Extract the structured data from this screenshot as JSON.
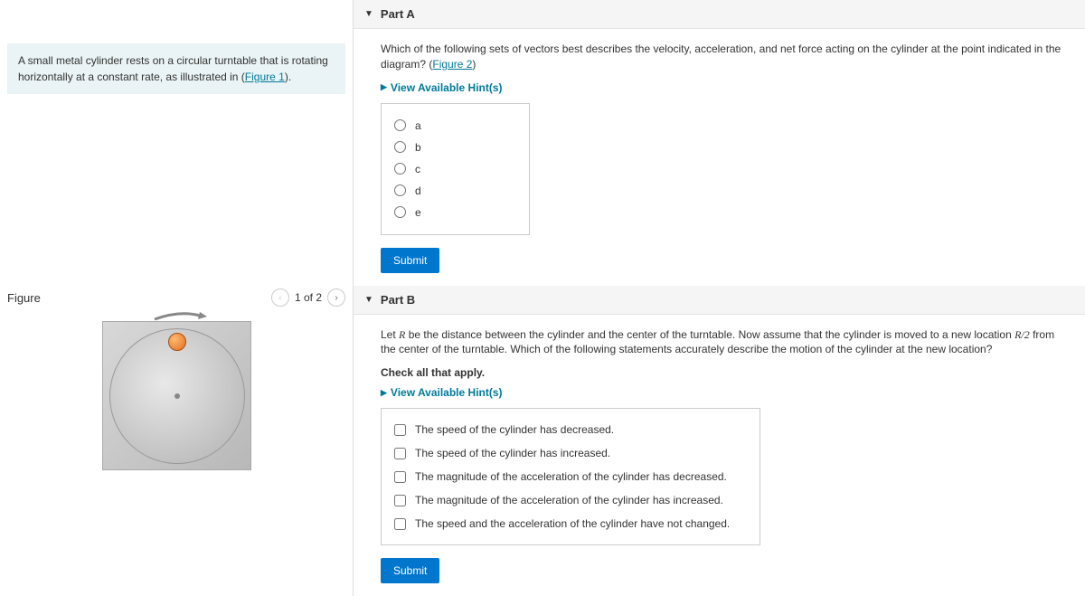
{
  "intro": {
    "text_before_link": "A small metal cylinder rests on a circular turntable that is rotating horizontally at a constant rate, as illustrated in (",
    "link_text": "Figure 1",
    "text_after_link": ")."
  },
  "figure": {
    "title": "Figure",
    "page_label": "1 of 2"
  },
  "partA": {
    "header": "Part A",
    "question_before_link": "Which of the following sets of vectors best describes the velocity, acceleration, and net force acting on the cylinder at the point indicated in the diagram? (",
    "question_link": "Figure 2",
    "question_after_link": ")",
    "hints_label": "View Available Hint(s)",
    "options": [
      "a",
      "b",
      "c",
      "d",
      "e"
    ],
    "submit": "Submit"
  },
  "partB": {
    "header": "Part B",
    "q_seg1": "Let ",
    "q_var1": "R",
    "q_seg2": " be the distance between the cylinder and the center of the turntable. Now assume that the cylinder is moved to a new location ",
    "q_var2": "R/2",
    "q_seg3": " from the center of the turntable. Which of the following statements accurately describe the motion of the cylinder at the new location?",
    "instruction": "Check all that apply.",
    "hints_label": "View Available Hint(s)",
    "options": [
      "The speed of the cylinder has decreased.",
      "The speed of the cylinder has increased.",
      "The magnitude of the acceleration of the cylinder has decreased.",
      "The magnitude of the acceleration of the cylinder has increased.",
      "The speed and the acceleration of the cylinder have not changed."
    ],
    "submit": "Submit"
  }
}
